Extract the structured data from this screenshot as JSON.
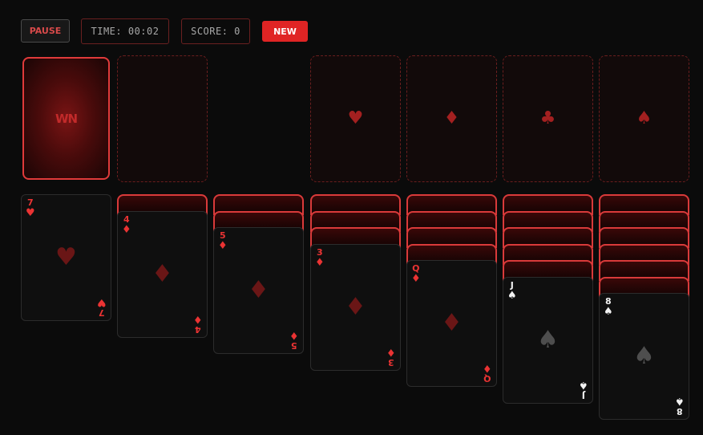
{
  "toolbar": {
    "pause_label": "PAUSE",
    "time_text": "TIME: 00:02",
    "score_text": "SCORE: 0",
    "new_label": "NEW"
  },
  "stock": {
    "logo": "WN"
  },
  "foundations": [
    {
      "suit": "hearts",
      "symbol": "♥"
    },
    {
      "suit": "diamonds",
      "symbol": "♦"
    },
    {
      "suit": "clubs",
      "symbol": "♣"
    },
    {
      "suit": "spades",
      "symbol": "♠"
    }
  ],
  "tableau": [
    {
      "face_down": 0,
      "top": {
        "rank": "7",
        "suit": "hearts",
        "symbol": "♥",
        "color": "red"
      }
    },
    {
      "face_down": 1,
      "top": {
        "rank": "4",
        "suit": "diamonds",
        "symbol": "♦",
        "color": "red"
      }
    },
    {
      "face_down": 2,
      "top": {
        "rank": "5",
        "suit": "diamonds",
        "symbol": "♦",
        "color": "red"
      }
    },
    {
      "face_down": 3,
      "top": {
        "rank": "3",
        "suit": "diamonds",
        "symbol": "♦",
        "color": "red"
      }
    },
    {
      "face_down": 4,
      "top": {
        "rank": "Q",
        "suit": "diamonds",
        "symbol": "♦",
        "color": "red"
      }
    },
    {
      "face_down": 5,
      "top": {
        "rank": "J",
        "suit": "spades",
        "symbol": "♠",
        "color": "black"
      }
    },
    {
      "face_down": 6,
      "top": {
        "rank": "8",
        "suit": "spades",
        "symbol": "♠",
        "color": "black"
      }
    }
  ],
  "colors": {
    "accent": "#e02424",
    "red_suit": "#ea3333",
    "card_border": "#d93a3a"
  }
}
